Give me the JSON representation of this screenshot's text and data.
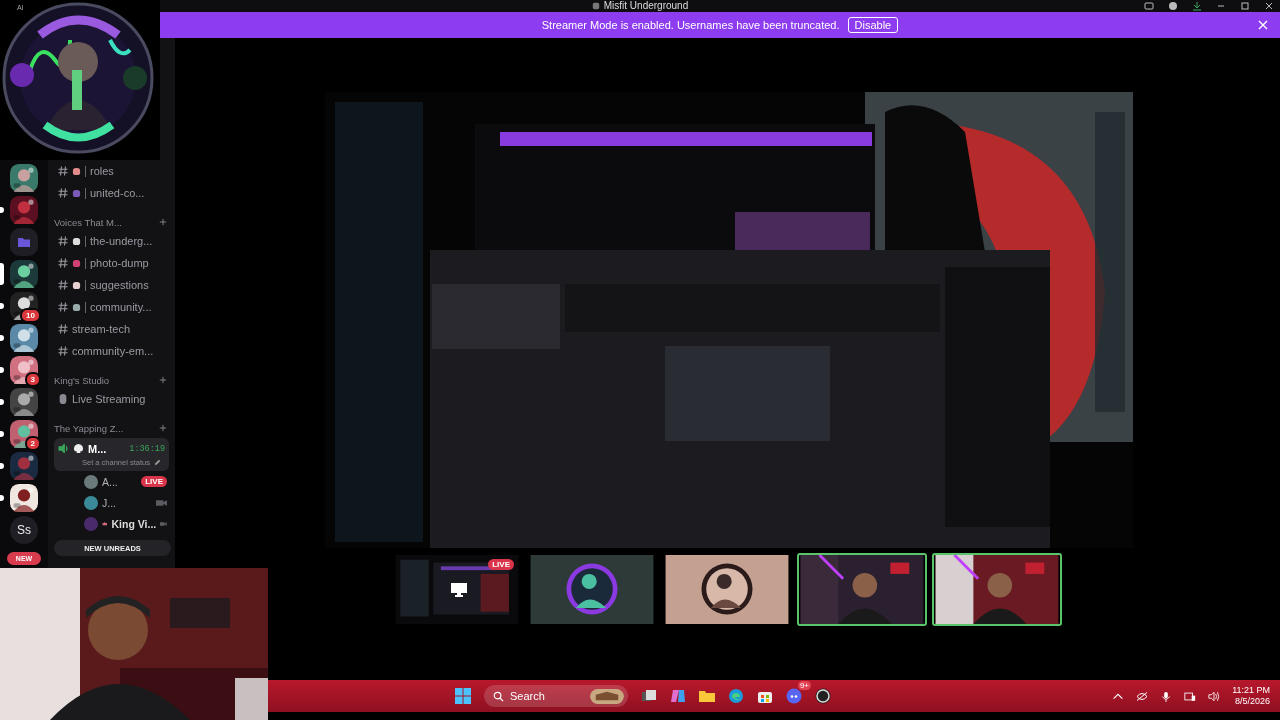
{
  "window": {
    "title": "Misfit Underground"
  },
  "overlay_label": "Al",
  "banner": {
    "text": "Streamer Mode is enabled. Usernames have been truncated.",
    "button": "Disable"
  },
  "servers": [
    {
      "kind": "picture",
      "selected": false,
      "unread": false
    },
    {
      "kind": "picture",
      "selected": false,
      "unread": true
    },
    {
      "kind": "folder",
      "selected": false,
      "unread": false
    },
    {
      "kind": "picture",
      "selected": true,
      "unread": false
    },
    {
      "kind": "picture",
      "selected": false,
      "unread": true,
      "badge": "10"
    },
    {
      "kind": "picture",
      "selected": false,
      "unread": true
    },
    {
      "kind": "picture",
      "selected": false,
      "unread": true,
      "badge": "3"
    },
    {
      "kind": "picture",
      "selected": false,
      "unread": true
    },
    {
      "kind": "picture",
      "selected": false,
      "unread": true,
      "badge": "2"
    },
    {
      "kind": "picture",
      "selected": false,
      "unread": true
    },
    {
      "kind": "picture",
      "selected": false,
      "unread": true
    },
    {
      "kind": "initials",
      "selected": false,
      "unread": false,
      "label": "Ss"
    }
  ],
  "new_pill": "NEW",
  "channels": [
    {
      "kind": "text",
      "name": "roles",
      "emoji": true,
      "selected": false
    },
    {
      "kind": "text",
      "name": "united-co...",
      "emoji": true,
      "selected": false
    },
    {
      "kind": "category",
      "name": "Voices That M..."
    },
    {
      "kind": "text",
      "name": "the-underg...",
      "emoji": true,
      "selected": false
    },
    {
      "kind": "text",
      "name": "photo-dump",
      "emoji": true,
      "selected": false
    },
    {
      "kind": "text",
      "name": "suggestions",
      "emoji": true,
      "selected": false
    },
    {
      "kind": "text",
      "name": "community...",
      "emoji": true,
      "selected": false
    },
    {
      "kind": "text",
      "name": "stream-tech",
      "emoji": false,
      "selected": false
    },
    {
      "kind": "text",
      "name": "community-em...",
      "emoji": false,
      "selected": false
    },
    {
      "kind": "category",
      "name": "King's Studio"
    },
    {
      "kind": "stage",
      "name": "Live Streaming",
      "emoji": false,
      "selected": false
    },
    {
      "kind": "category",
      "name": "The Yapping Z..."
    },
    {
      "kind": "voice",
      "name": "M...",
      "emoji": true,
      "selected": true,
      "time": "1:36:19",
      "status": "Set a channel status"
    }
  ],
  "members": [
    {
      "name": "A...",
      "badge": "LIVE",
      "crown": false
    },
    {
      "name": "J...",
      "crown": false
    },
    {
      "name": "King Vi...",
      "crown": true
    }
  ],
  "new_unreads": "NEW UNREADS",
  "stream": {
    "kind": "picture"
  },
  "tiles": [
    {
      "kind": "screen",
      "badge": "LIVE",
      "speaking": false
    },
    {
      "kind": "avatar",
      "speaking": false
    },
    {
      "kind": "avatar",
      "speaking": false
    },
    {
      "kind": "camera",
      "speaking": true
    },
    {
      "kind": "camera",
      "speaking": true
    }
  ],
  "taskbar": {
    "search": "Search",
    "discord_badge": "9+",
    "time": "11:21 PM",
    "date": "8/5/2026"
  }
}
